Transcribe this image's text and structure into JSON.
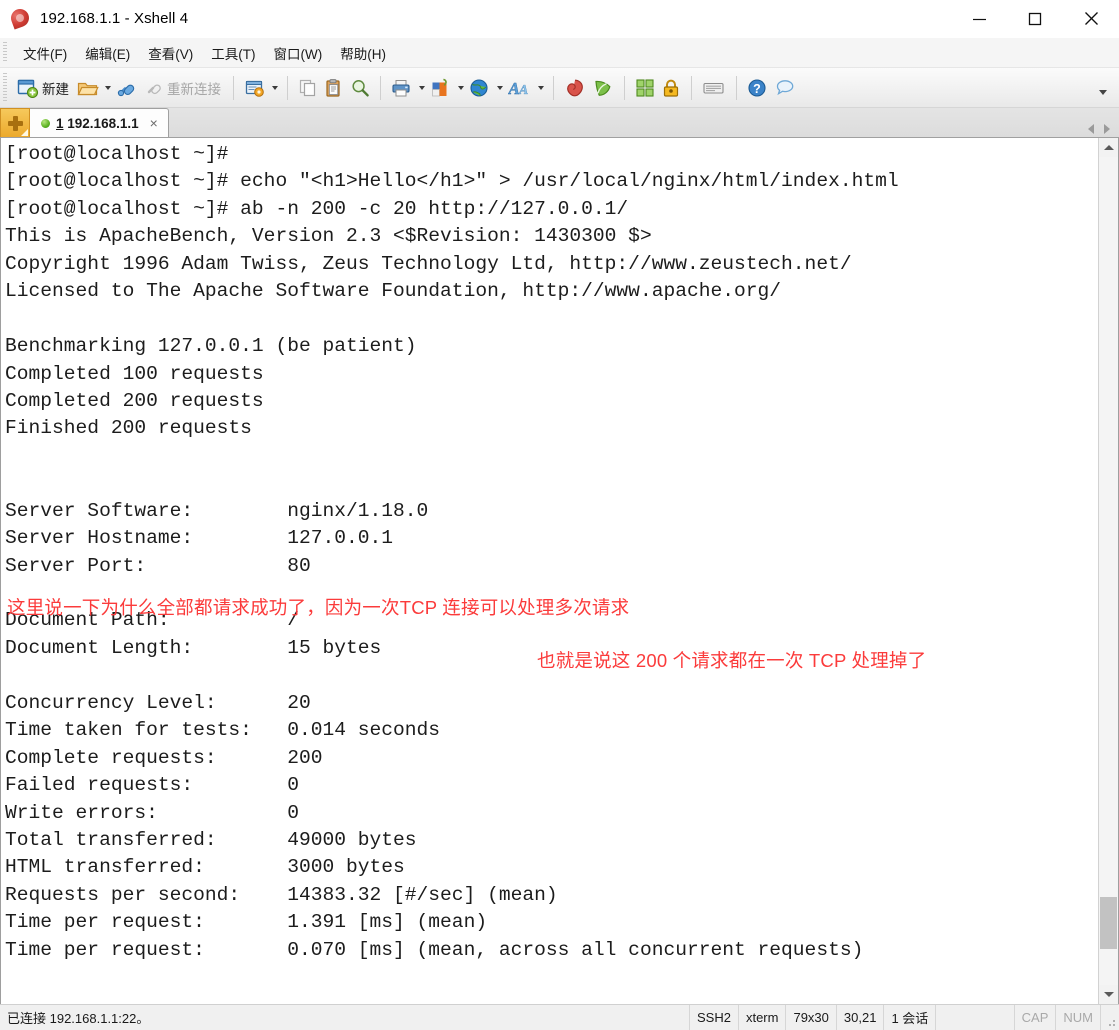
{
  "window": {
    "title": "192.168.1.1 - Xshell 4",
    "icon": "xshell-icon",
    "controls": {
      "minimize": "minimize-button",
      "maximize": "maximize-button",
      "close": "close-button"
    }
  },
  "menubar": {
    "items": [
      {
        "label": "文件(F)",
        "name": "menu-file"
      },
      {
        "label": "编辑(E)",
        "name": "menu-edit"
      },
      {
        "label": "查看(V)",
        "name": "menu-view"
      },
      {
        "label": "工具(T)",
        "name": "menu-tools"
      },
      {
        "label": "窗口(W)",
        "name": "menu-window"
      },
      {
        "label": "帮助(H)",
        "name": "menu-help"
      }
    ]
  },
  "toolbar": {
    "new_label": "新建",
    "reconnect_label": "重新连接",
    "icons": [
      "new-session-icon",
      "open-folder-icon",
      "connect-icon",
      "reconnect-icon",
      "session-properties-icon",
      "copy-icon",
      "paste-icon",
      "find-icon",
      "print-icon",
      "color-scheme-icon",
      "globe-icon",
      "font-icon",
      "xshell-icon",
      "xftp-icon",
      "layout-icon",
      "lock-icon",
      "keyboard-icon",
      "help-icon",
      "chat-icon"
    ],
    "overflow": "toolbar-overflow-icon"
  },
  "tabstrip": {
    "new_tab": "new-tab-button",
    "tabs": [
      {
        "number": "1",
        "title": "192.168.1.1",
        "status": "connected",
        "close": "×"
      }
    ],
    "nav_left": "tab-nav-left",
    "nav_right": "tab-nav-right"
  },
  "terminal": {
    "lines": [
      "[root@localhost ~]#",
      "[root@localhost ~]# echo \"<h1>Hello</h1>\" > /usr/local/nginx/html/index.html",
      "[root@localhost ~]# ab -n 200 -c 20 http://127.0.0.1/",
      "This is ApacheBench, Version 2.3 <$Revision: 1430300 $>",
      "Copyright 1996 Adam Twiss, Zeus Technology Ltd, http://www.zeustech.net/",
      "Licensed to The Apache Software Foundation, http://www.apache.org/",
      "",
      "Benchmarking 127.0.0.1 (be patient)",
      "Completed 100 requests",
      "Completed 200 requests",
      "Finished 200 requests",
      "",
      "",
      "Server Software:        nginx/1.18.0",
      "Server Hostname:        127.0.0.1",
      "Server Port:            80",
      "",
      "Document Path:          /",
      "Document Length:        15 bytes",
      "",
      "Concurrency Level:      20",
      "Time taken for tests:   0.014 seconds",
      "Complete requests:      200",
      "Failed requests:        0",
      "Write errors:           0",
      "Total transferred:      49000 bytes",
      "HTML transferred:       3000 bytes",
      "Requests per second:    14383.32 [#/sec] (mean)",
      "Time per request:       1.391 [ms] (mean)",
      "Time per request:       0.070 [ms] (mean, across all concurrent requests)"
    ],
    "annotations": [
      {
        "text": "这里说一下为什么全部都请求成功了，因为一次TCP 连接可以处理多次请求",
        "color": "#fb3b3b"
      },
      {
        "text": "也就是说这 200 个请求都在一次 TCP 处理掉了",
        "color": "#fb3b3b"
      }
    ],
    "scrollbar": {
      "up": "scroll-up-arrow",
      "down": "scroll-down-arrow",
      "thumb": "scroll-thumb"
    }
  },
  "statusbar": {
    "connection": "已连接 192.168.1.1:22。",
    "protocol": "SSH2",
    "emulation": "xterm",
    "size": "79x30",
    "cursor": "30,21",
    "sessions": "1 会话",
    "caps": "CAP",
    "num": "NUM"
  },
  "colors": {
    "accent_red": "#fb3b3b",
    "tab_orange": "#eca92c",
    "status_green": "#5cb223",
    "terminal_fg": "#1c1c1c",
    "terminal_bg": "#ffffff"
  }
}
